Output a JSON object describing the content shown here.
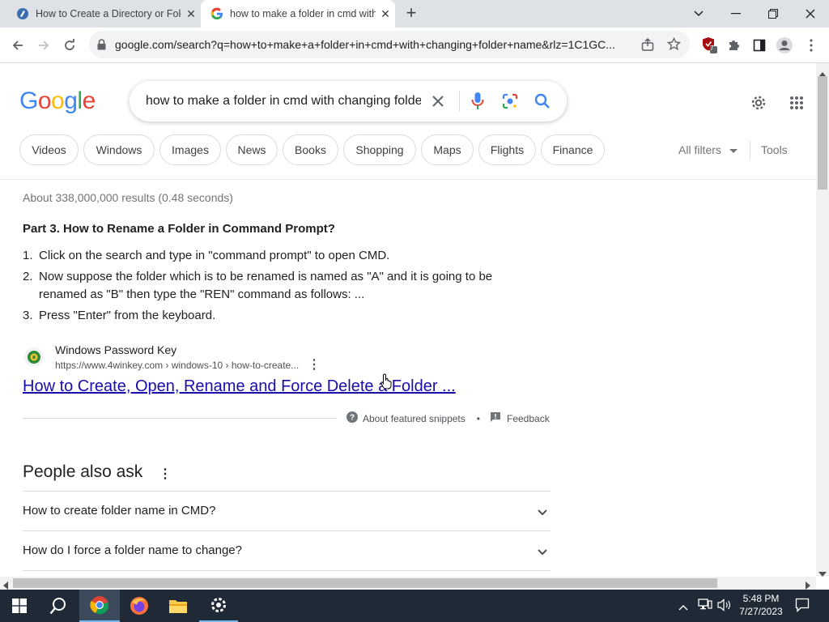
{
  "browser": {
    "tabs": [
      {
        "title": "How to Create a Directory or Folder",
        "active": false
      },
      {
        "title": "how to make a folder in cmd with changing folder name",
        "active": true
      }
    ],
    "new_tab": "+",
    "url": "google.com/search?q=how+to+make+a+folder+in+cmd+with+changing+folder+name&rlz=1C1GC...",
    "extension_badge": "7"
  },
  "search": {
    "logo": [
      "G",
      "o",
      "o",
      "g",
      "l",
      "e"
    ],
    "logo_colors": [
      "#4285F4",
      "#EA4335",
      "#FBBC05",
      "#4285F4",
      "#34A853",
      "#EA4335"
    ],
    "query": "how to make a folder in cmd with changing folder name",
    "chips": [
      "Videos",
      "Windows",
      "Images",
      "News",
      "Books",
      "Shopping",
      "Maps",
      "Flights",
      "Finance"
    ],
    "all_filters": "All filters",
    "tools": "Tools",
    "stats": "About 338,000,000 results (0.48 seconds)"
  },
  "snippet": {
    "title": "Part 3. How to Rename a Folder in Command Prompt?",
    "steps": [
      {
        "num": "1.",
        "text": "Click on the search and type in \"command prompt\" to open CMD."
      },
      {
        "num": "2.",
        "text": "Now suppose the folder which is to be renamed is named as \"A\" and it is going to be renamed as \"B\" then type the \"REN\" command as follows: ..."
      },
      {
        "num": "3.",
        "text": "Press \"Enter\" from the keyboard."
      }
    ],
    "site_name": "Windows Password Key",
    "site_url": "https://www.4winkey.com › windows-10 › how-to-create...",
    "link": "How to Create, Open, Rename and Force Delete a Folder ...",
    "about": "About featured snippets",
    "dot": "•",
    "feedback": "Feedback"
  },
  "paa": {
    "title": "People also ask",
    "questions": [
      "How to create folder name in CMD?",
      "How do I force a folder name to change?"
    ]
  },
  "taskbar": {
    "time": "5:48 PM",
    "date": "7/27/2023"
  },
  "colors": {
    "link": "#1a0dab",
    "accent": "#1a73e8"
  }
}
